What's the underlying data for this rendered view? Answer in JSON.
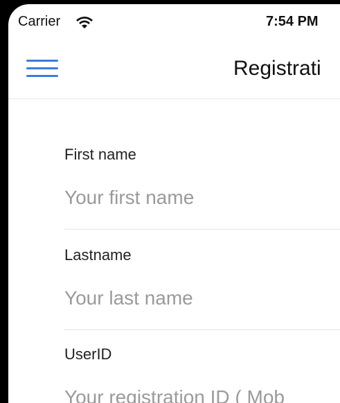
{
  "status_bar": {
    "carrier": "Carrier",
    "time": "7:54 PM"
  },
  "nav": {
    "title": "Registrati",
    "menu_icon": "hamburger-menu-icon",
    "accent_color": "#3b7dd8"
  },
  "form": {
    "fields": [
      {
        "label": "First name",
        "placeholder": "Your first name",
        "value": ""
      },
      {
        "label": "Lastname",
        "placeholder": "Your last name",
        "value": ""
      },
      {
        "label": "UserID",
        "placeholder": "Your registration ID ( Mob",
        "value": ""
      }
    ]
  }
}
